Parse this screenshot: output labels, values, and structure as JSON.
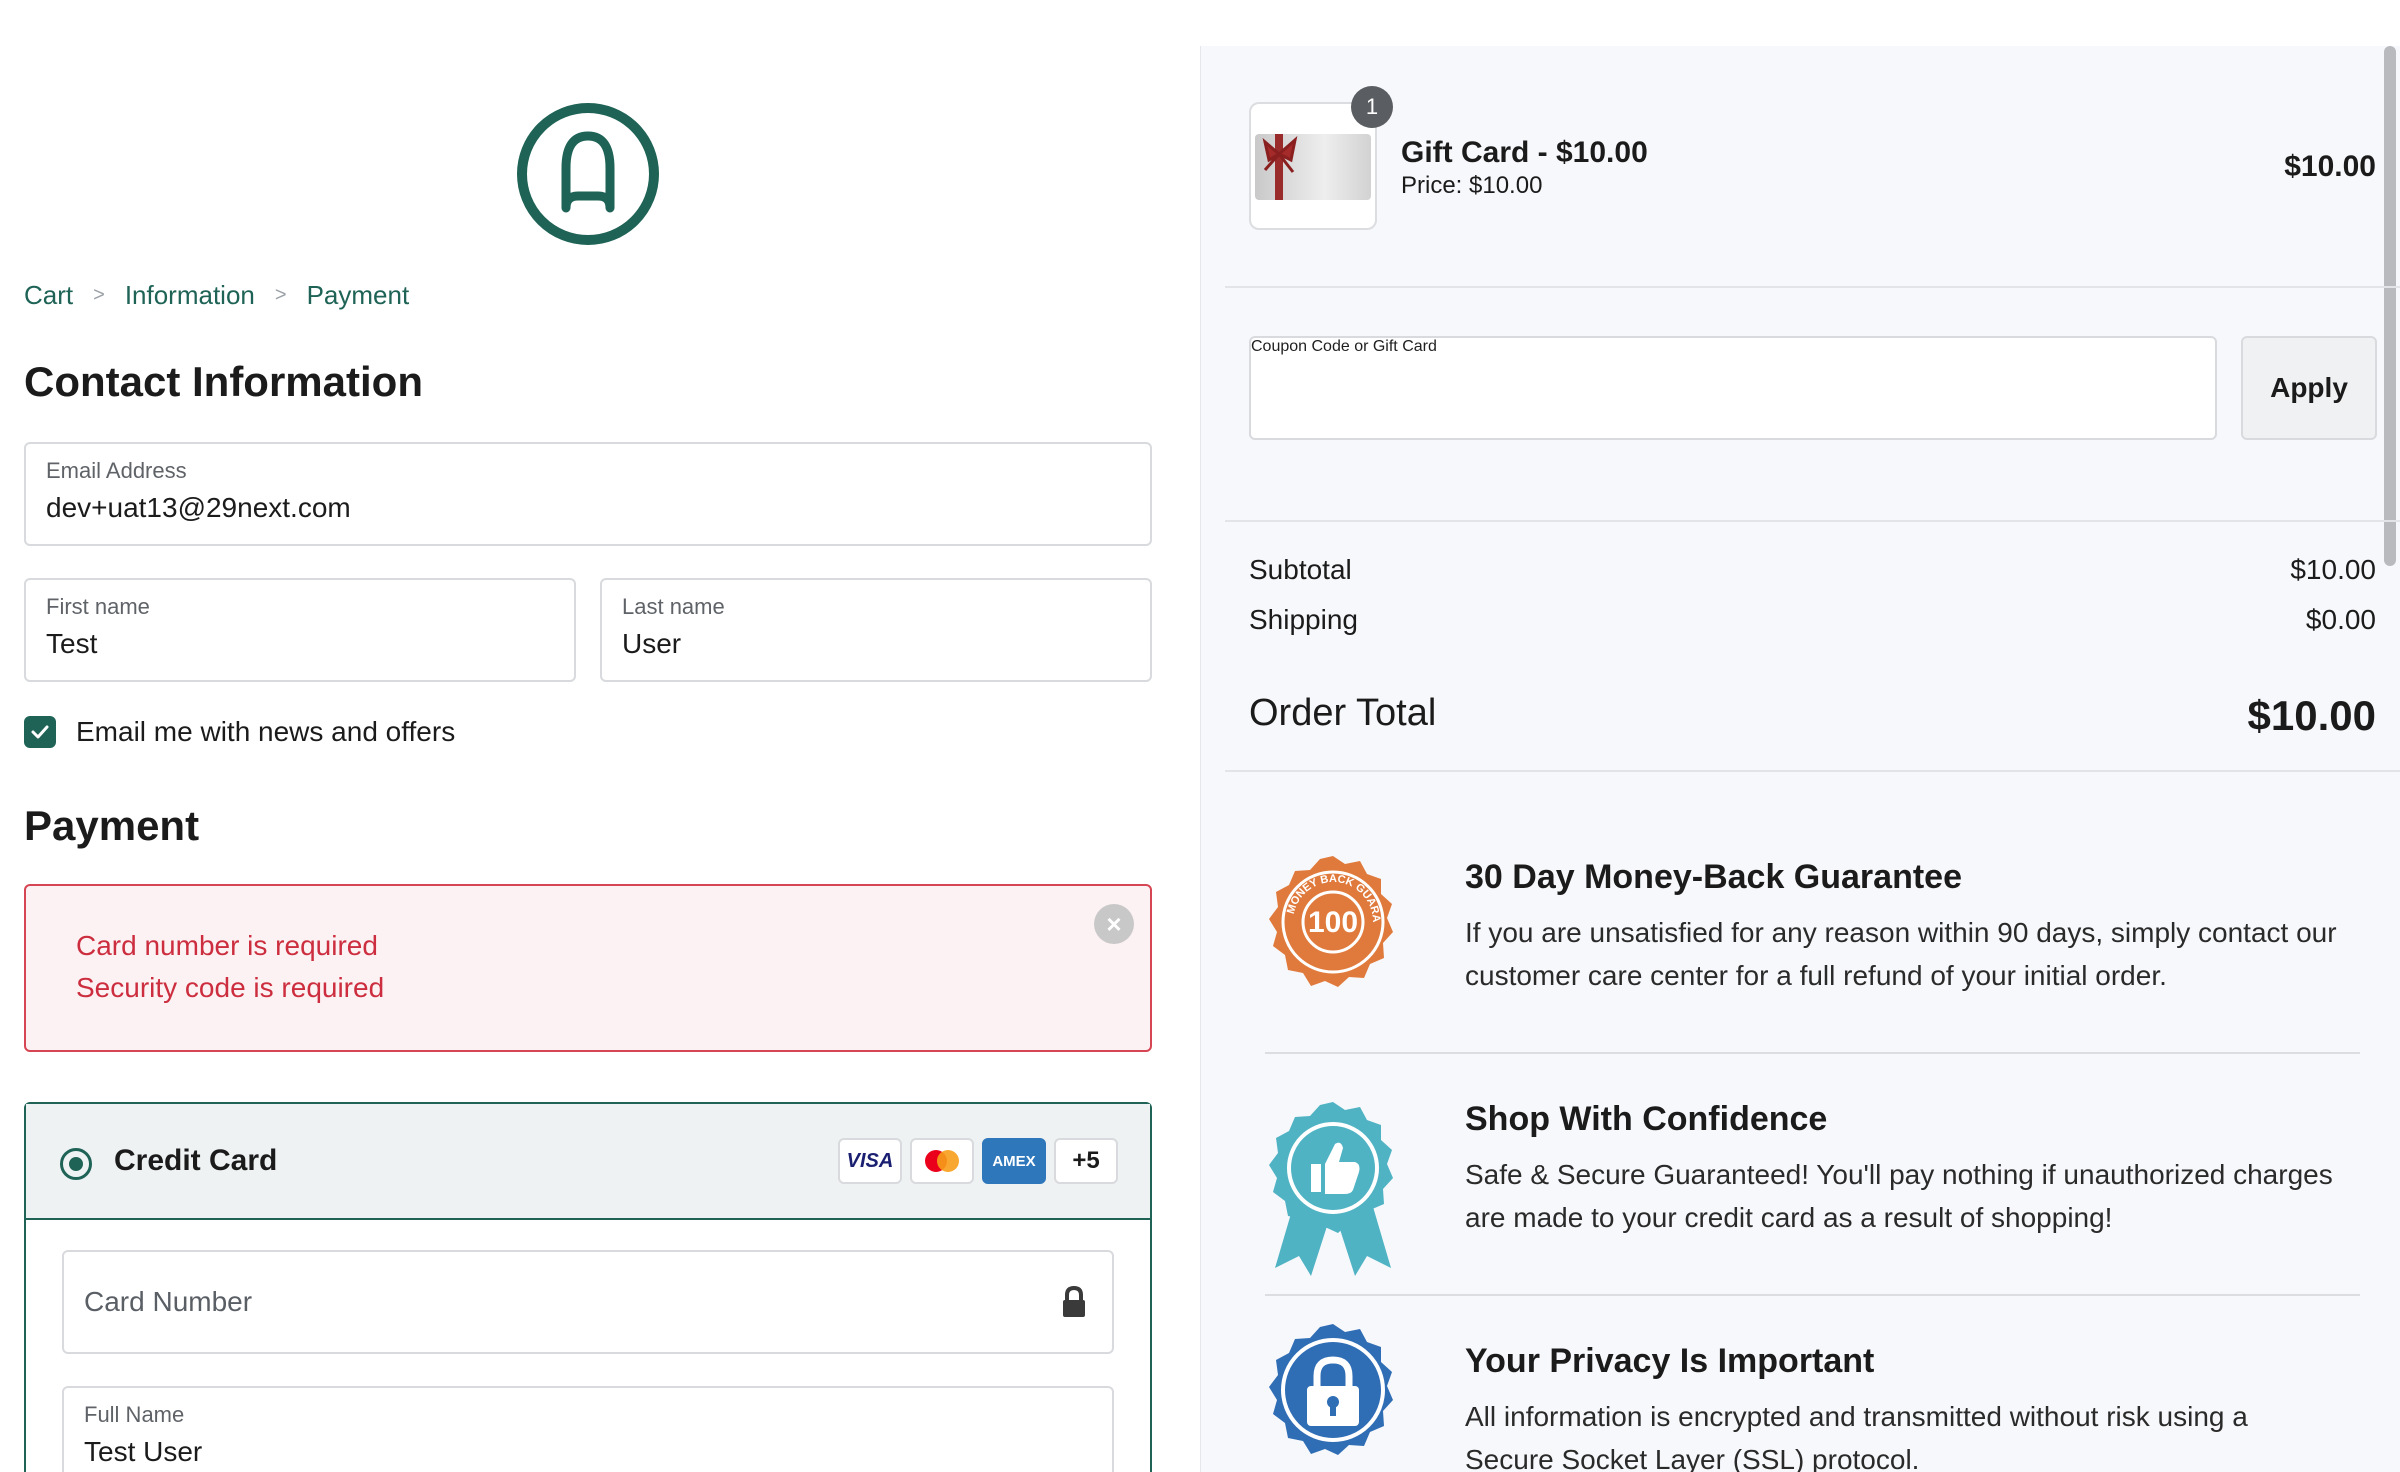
{
  "breadcrumb": {
    "cart": "Cart",
    "information": "Information",
    "payment": "Payment",
    "separator": ">"
  },
  "contact": {
    "title": "Contact Information",
    "email_label": "Email Address",
    "email_value": "dev+uat13@29next.com",
    "first_label": "First name",
    "first_value": "Test",
    "last_label": "Last name",
    "last_value": "User",
    "newsletter_label": "Email me with news and offers",
    "newsletter_checked": true
  },
  "payment": {
    "title": "Payment",
    "errors": [
      "Card number is required",
      "Security code is required"
    ],
    "method_label": "Credit Card",
    "card_brands": [
      "VISA",
      "mastercard",
      "AMEX",
      "+5"
    ],
    "card_number_placeholder": "Card Number",
    "full_name_label": "Full Name",
    "full_name_value": "Test User"
  },
  "order": {
    "item": {
      "quantity": "1",
      "name": "Gift Card - $10.00",
      "price_line": "Price: $10.00",
      "line_total": "$10.00"
    },
    "coupon_placeholder": "Coupon Code or Gift Card",
    "apply_label": "Apply",
    "subtotal_label": "Subtotal",
    "subtotal_value": "$10.00",
    "shipping_label": "Shipping",
    "shipping_value": "$0.00",
    "total_label": "Order Total",
    "total_value": "$10.00"
  },
  "guarantees": [
    {
      "title": "30 Day Money-Back Guarantee",
      "desc": "If you are unsatisfied for any reason within 90 days, simply contact our customer care center for a full refund of your initial order.",
      "icon": "money-back-seal-icon",
      "seal_text": "100",
      "seal_ring": "MONEY BACK GUARANTEED"
    },
    {
      "title": "Shop With Confidence",
      "desc": "Safe & Secure Guaranteed! You'll pay nothing if unauthorized charges are made to your credit card as a result of shopping!",
      "icon": "thumbs-up-ribbon-icon"
    },
    {
      "title": "Your Privacy Is Important",
      "desc": "All information is encrypted and transmitted without risk using a Secure Socket Layer (SSL) protocol.",
      "icon": "padlock-seal-icon"
    }
  ],
  "colors": {
    "brand": "#1e6356",
    "error": "#cc2e3f",
    "seal_orange": "#e07a3c",
    "ribbon_teal": "#4fb3c4",
    "privacy_blue": "#2f6db5"
  }
}
